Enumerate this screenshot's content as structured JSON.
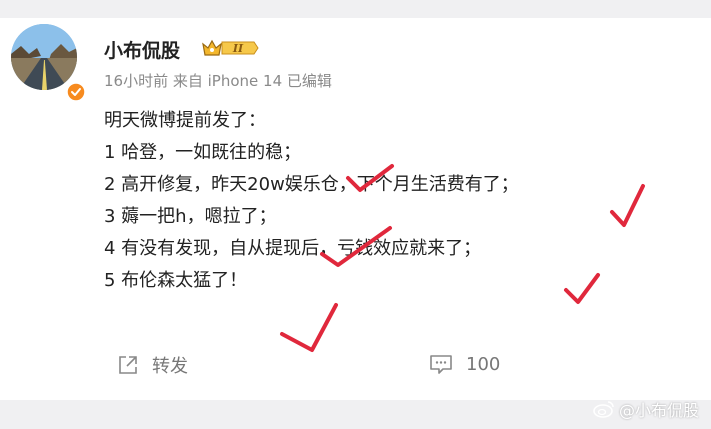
{
  "post": {
    "username": "小布侃股",
    "vip_level": "II",
    "meta": "16小时前  来自 iPhone 14  已编辑",
    "lines": [
      "明天微博提前发了：",
      "1 哈登，一如既往的稳；",
      "2 高开修复，昨天20w娱乐仓，下个月生活费有了；",
      "3 薅一把h，嗯拉了；",
      "4 有没有发现，自从提现后，亏钱效应就来了；",
      "5 布伦森太猛了！"
    ]
  },
  "actions": {
    "repost_label": "转发",
    "comment_count": "100"
  },
  "watermark": "@小布侃股",
  "colors": {
    "check_mark": "#e0283c",
    "verified": "#f78b1f",
    "vip_gold": "#f3b72d"
  }
}
